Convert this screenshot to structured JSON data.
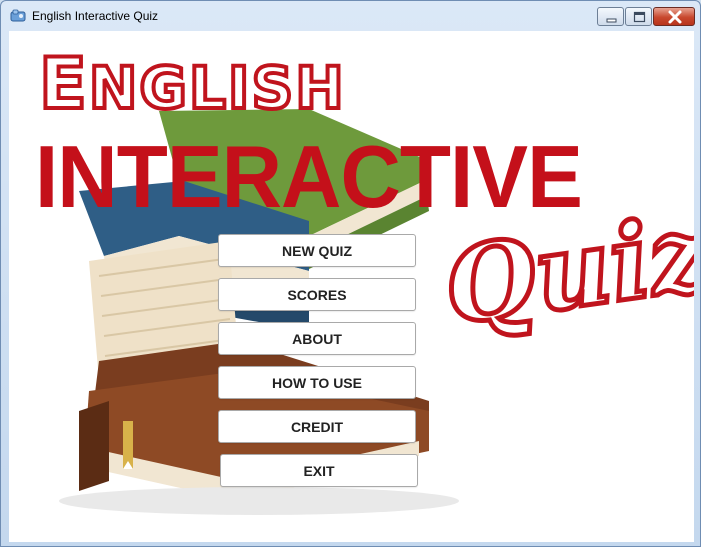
{
  "window": {
    "title": "English Interactive Quiz",
    "icons": {
      "app": "app-icon",
      "minimize": "minimize-icon",
      "maximize": "maximize-icon",
      "close": "close-icon"
    }
  },
  "logo": {
    "line1_initial": "E",
    "line1_rest": "NGLISH",
    "line2": "INTERACTIVE",
    "line3": "Quiz",
    "colors": {
      "red": "#c4101a",
      "outline": "#c0141d"
    }
  },
  "menu": {
    "items": [
      {
        "label": "NEW QUIZ"
      },
      {
        "label": "SCORES"
      },
      {
        "label": "ABOUT"
      },
      {
        "label": "HOW TO USE"
      },
      {
        "label": "CREDIT"
      },
      {
        "label": "EXIT"
      }
    ]
  },
  "colors": {
    "book_green": "#6e9a3c",
    "book_blue": "#2f5e86",
    "book_brown": "#7a3d1f",
    "pages": "#f1e6d2"
  }
}
